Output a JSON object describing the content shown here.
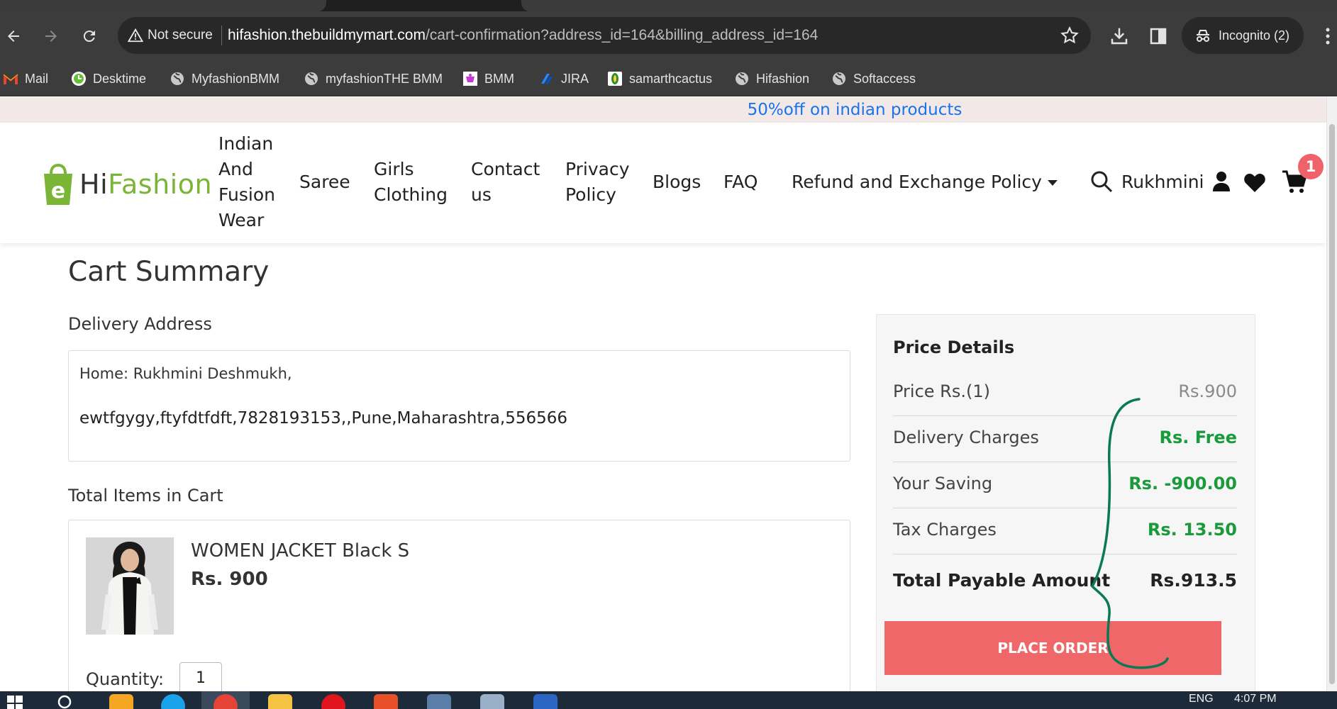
{
  "browser": {
    "omnibox": {
      "security_label": "Not secure",
      "url_host": "hifashion.thebuildmymart.com",
      "url_path": "/cart-confirmation?address_id=164&billing_address_id=164"
    },
    "incognito_label": "Incognito (2)",
    "bookmarks": [
      {
        "label": "Mail",
        "icon": "gmail-icon"
      },
      {
        "label": "Desktime",
        "icon": "desktime-icon"
      },
      {
        "label": "MyfashionBMM",
        "icon": "globe-icon"
      },
      {
        "label": "myfashionTHE BMM",
        "icon": "globe-icon"
      },
      {
        "label": "BMM",
        "icon": "bmm-icon"
      },
      {
        "label": "JIRA",
        "icon": "jira-icon"
      },
      {
        "label": "samarthcactus",
        "icon": "cactus-icon"
      },
      {
        "label": "Hifashion",
        "icon": "globe-icon"
      },
      {
        "label": "Softaccess",
        "icon": "globe-icon"
      }
    ]
  },
  "announcement": "50%off on indian products",
  "header": {
    "logo_hi": "Hi",
    "logo_fashion": "Fashion",
    "nav": [
      {
        "label": "Indian And Fusion Wear"
      },
      {
        "label": "Saree"
      },
      {
        "label": "Girls Clothing"
      },
      {
        "label": "Contact us"
      },
      {
        "label": "Privacy Policy"
      },
      {
        "label": "Blogs"
      },
      {
        "label": "FAQ"
      },
      {
        "label": "Refund and Exchange Policy"
      }
    ],
    "user_name": "Rukhmini",
    "cart_count": "1"
  },
  "cart": {
    "title": "Cart Summary",
    "delivery_label": "Delivery Address",
    "address_line1": "Home: Rukhmini Deshmukh,",
    "address_line2": "ewtfgygy,ftyfdtfdft,7828193153,,Pune,Maharashtra,556566",
    "items_label": "Total Items in Cart",
    "item": {
      "name": "WOMEN JACKET Black S",
      "price": "Rs. 900",
      "quantity_label": "Quantity:",
      "quantity": "1"
    }
  },
  "price_details": {
    "title": "Price Details",
    "rows": [
      {
        "label": "Price Rs.(1)",
        "value": "Rs.900",
        "color": "#8a8a8a"
      },
      {
        "label": "Delivery Charges",
        "value": "Rs. Free",
        "color": "#1a9a3a"
      },
      {
        "label": "Your Saving",
        "value": "Rs. -900.00",
        "color": "#1a9a3a"
      },
      {
        "label": "Tax Charges",
        "value": "Rs. 13.50",
        "color": "#1a9a3a"
      }
    ],
    "total_label": "Total Payable Amount",
    "total_value": "Rs.913.5",
    "place_order_label": "PLACE ORDER"
  },
  "taskbar": {
    "language": "ENG",
    "time": "4:07 PM"
  },
  "colors": {
    "accent_green": "#7bb536",
    "place_order": "#f0676a",
    "announcement_text": "#1a73e8",
    "annotation_ink": "#0a7a55"
  }
}
